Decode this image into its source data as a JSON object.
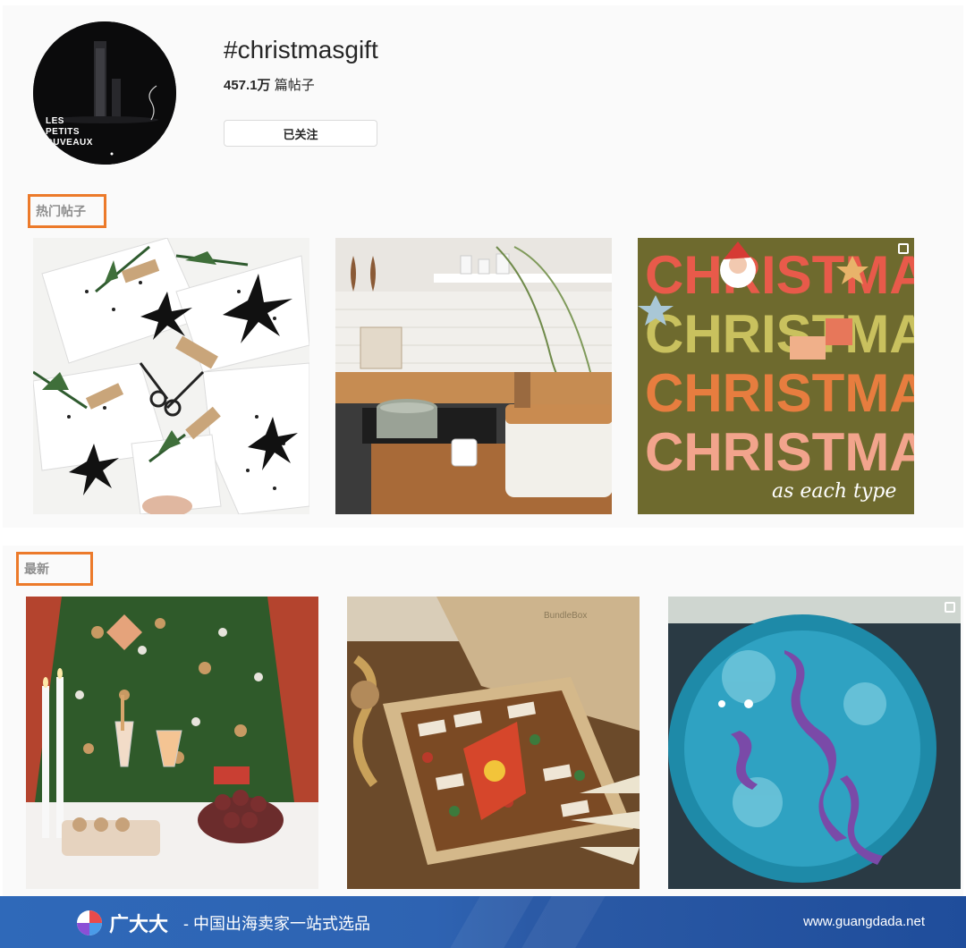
{
  "header": {
    "hashtag": "#christmasgift",
    "post_count": "457.1万",
    "post_count_suffix": " 篇帖子",
    "follow_button": "已关注",
    "avatar_text": [
      "LES",
      "PETITS",
      "OUVEAUX"
    ]
  },
  "sections": {
    "top_posts_label": "热门帖子",
    "latest_label": "最新"
  },
  "top_posts": [
    {
      "subject": "wrapped-gifts-with-black-stars"
    },
    {
      "subject": "kitchen-counter"
    },
    {
      "subject": "christmas-lettering",
      "lines": [
        "CHRISTMAS",
        "CHRISTMAS",
        "CHRISTMAS",
        "CHRISTMAS"
      ],
      "caption": "as each type",
      "multi": true
    }
  ],
  "latest_posts": [
    {
      "subject": "christmas-tree-table"
    },
    {
      "subject": "chocolate-gift-box",
      "box_label": "BundleBox"
    },
    {
      "subject": "painted-bowl",
      "multi": true
    }
  ],
  "banner": {
    "brand": "广大大",
    "slogan": "- 中国出海卖家一站式选品",
    "url": "www.guangdada.net"
  },
  "colors": {
    "highlight_border": "#ec7a2a",
    "banner_bg": "#2f69b9"
  }
}
